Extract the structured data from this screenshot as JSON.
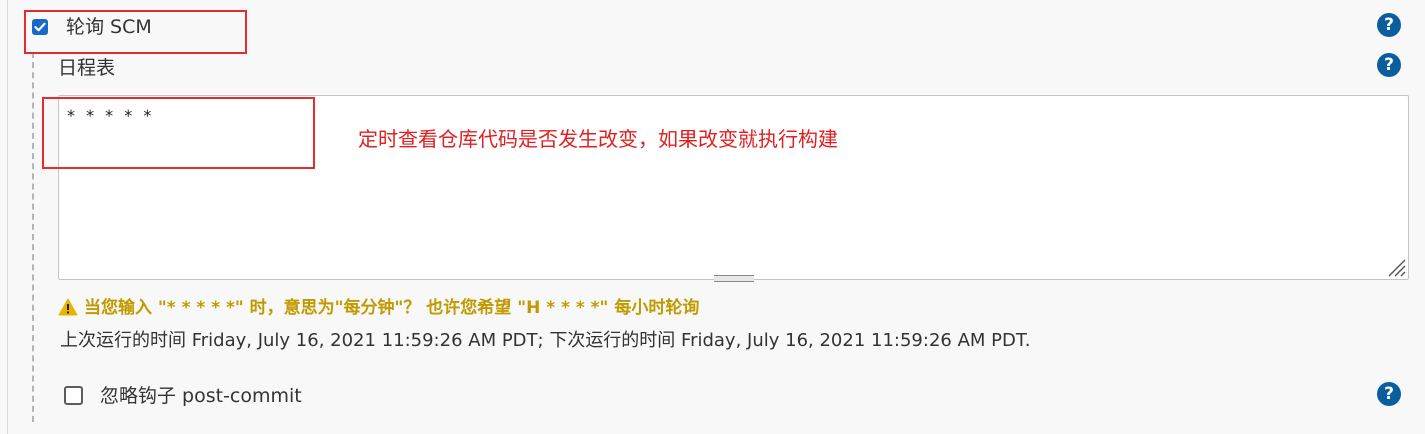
{
  "poll_scm": {
    "label": "轮询 SCM",
    "checked": true
  },
  "schedule": {
    "label": "日程表",
    "value": "* * * * *",
    "annotation": "定时查看仓库代码是否发生改变，如果改变就执行构建"
  },
  "warning": "当您输入 \"* * * * *\" 时，意思为\"每分钟\"？ 也许您希望 \"H * * * *\" 每小时轮询",
  "run_info": "上次运行的时间 Friday, July 16, 2021 11:59:26 AM PDT; 下次运行的时间 Friday, July 16, 2021 11:59:26 AM PDT.",
  "ignore_post_commit": {
    "label": "忽略钩子 post-commit",
    "checked": false
  },
  "help_icon_text": "?",
  "colors": {
    "accent": "#1769c9",
    "help": "#0b5e9e",
    "annotation_red": "#e02020",
    "warning": "#c19a00"
  }
}
